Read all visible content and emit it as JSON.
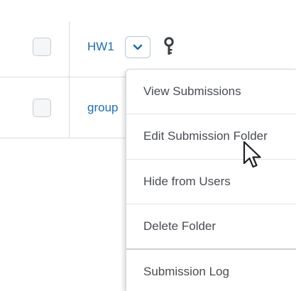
{
  "rows": [
    {
      "name": "HW1"
    },
    {
      "name": "group"
    }
  ],
  "icons": {
    "row_actions": "chevron-down-icon",
    "restriction": "key-icon",
    "cursor": "mouse-pointer-icon"
  },
  "menu": {
    "items": [
      {
        "label": "View Submissions"
      },
      {
        "label": "Edit Submission Folder"
      },
      {
        "label": "Hide from Users"
      },
      {
        "label": "Delete Folder"
      },
      {
        "label": "Submission Log"
      }
    ]
  },
  "colors": {
    "link": "#1b6fb7",
    "menu_text": "#494c52",
    "button_border": "#b8c7d6"
  }
}
